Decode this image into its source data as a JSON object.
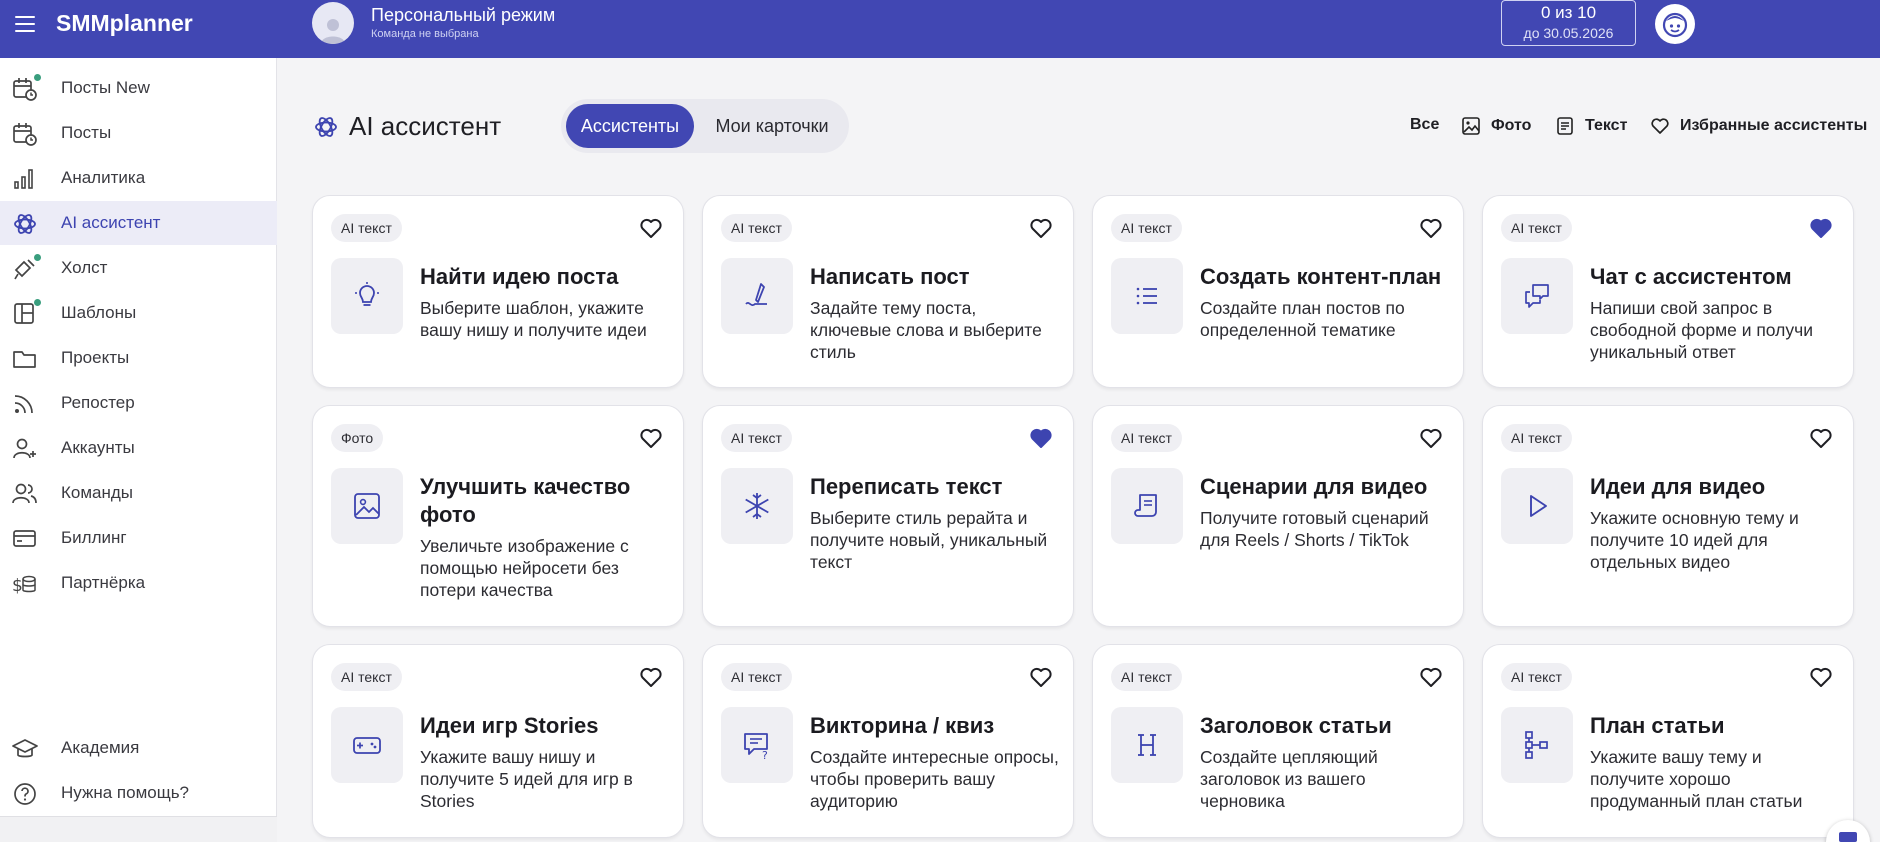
{
  "app": {
    "brand": "SMMplanner"
  },
  "workspace": {
    "title": "Персональный режим",
    "subtitle": "Команда не выбрана"
  },
  "plan": {
    "count": "0 из 10",
    "until": "до 30.05.2026"
  },
  "sidebar": {
    "items": [
      {
        "label": "Посты New",
        "icon": "calendar-clock-icon",
        "dot": true
      },
      {
        "label": "Посты",
        "icon": "calendar-clock-icon",
        "dot": false
      },
      {
        "label": "Аналитика",
        "icon": "bar-chart-icon",
        "dot": false
      },
      {
        "label": "AI ассистент",
        "icon": "ai-swirl-icon",
        "dot": false,
        "active": true
      },
      {
        "label": "Холст",
        "icon": "canvas-brush-icon",
        "dot": true
      },
      {
        "label": "Шаблоны",
        "icon": "templates-icon",
        "dot": true
      },
      {
        "label": "Проекты",
        "icon": "folder-icon",
        "dot": false
      },
      {
        "label": "Репостер",
        "icon": "rss-icon",
        "dot": false
      },
      {
        "label": "Аккаунты",
        "icon": "user-plus-icon",
        "dot": false
      },
      {
        "label": "Команды",
        "icon": "users-icon",
        "dot": false
      },
      {
        "label": "Биллинг",
        "icon": "card-icon",
        "dot": false
      },
      {
        "label": "Партнёрка",
        "icon": "coins-icon",
        "dot": false
      }
    ],
    "bottom": [
      {
        "label": "Академия",
        "icon": "graduation-cap-icon"
      },
      {
        "label": "Нужна помощь?",
        "icon": "help-circle-icon"
      }
    ]
  },
  "main": {
    "title": "AI ассистент",
    "tabs": [
      {
        "label": "Ассистенты",
        "active": true
      },
      {
        "label": "Мои карточки",
        "active": false
      }
    ],
    "filters": [
      {
        "label": "Все",
        "icon": ""
      },
      {
        "label": "Фото",
        "icon": "image-icon"
      },
      {
        "label": "Текст",
        "icon": "document-icon"
      },
      {
        "label": "Избранные ассистенты",
        "icon": "heart-outline-icon"
      }
    ]
  },
  "cards": [
    {
      "tag": "AI текст",
      "title": "Найти идею поста",
      "desc": "Выберите шаблон, укажите вашу нишу и получите идеи",
      "icon": "lightbulb-icon",
      "favorite": false
    },
    {
      "tag": "AI текст",
      "title": "Написать пост",
      "desc": "Задайте тему поста, ключевые слова и выберите стиль",
      "icon": "pen-write-icon",
      "favorite": false
    },
    {
      "tag": "AI текст",
      "title": "Создать контент-план",
      "desc": "Создайте план постов по определенной тематике",
      "icon": "list-icon",
      "favorite": false
    },
    {
      "tag": "AI текст",
      "title": "Чат с ассистентом",
      "desc": "Напиши свой запрос в свободной форме и получи уникальный ответ",
      "icon": "chat-bubbles-icon",
      "favorite": true
    },
    {
      "tag": "Фото",
      "title": "Улучшить качество фото",
      "desc": "Увеличьте изображение с помощью нейросети без потери качества",
      "icon": "image-icon",
      "favorite": false
    },
    {
      "tag": "AI текст",
      "title": "Переписать текст",
      "desc": "Выберите стиль рерайта и получите новый, уникальный текст",
      "icon": "snowflake-icon",
      "favorite": true
    },
    {
      "tag": "AI текст",
      "title": "Сценарии для видео",
      "desc": "Получите готовый сценарий для Reels / Shorts / TikTok",
      "icon": "script-scroll-icon",
      "favorite": false
    },
    {
      "tag": "AI текст",
      "title": "Идеи для видео",
      "desc": "Укажите основную тему и получите 10 идей для отдельных видео",
      "icon": "play-icon",
      "favorite": false
    },
    {
      "tag": "AI текст",
      "title": "Идеи игр Stories",
      "desc": "Укажите вашу нишу и получите 5 идей для игр в Stories",
      "icon": "gamepad-icon",
      "favorite": false
    },
    {
      "tag": "AI текст",
      "title": "Викторина / квиз",
      "desc": "Создайте интересные опросы, чтобы проверить вашу аудиторию",
      "icon": "quiz-bubble-icon",
      "favorite": false
    },
    {
      "tag": "AI текст",
      "title": "Заголовок статьи",
      "desc": "Создайте цепляющий заголовок из вашего черновика",
      "icon": "heading-h-icon",
      "favorite": false
    },
    {
      "tag": "AI текст",
      "title": "План статьи",
      "desc": "Укажите вашу тему и получите хорошо продуманный план статьи",
      "icon": "tree-structure-icon",
      "favorite": false
    }
  ],
  "colors": {
    "brand": "#4147b3",
    "accent": "#3d44b0",
    "dot": "#3a9e7e",
    "favorite": "#3d44b0"
  }
}
